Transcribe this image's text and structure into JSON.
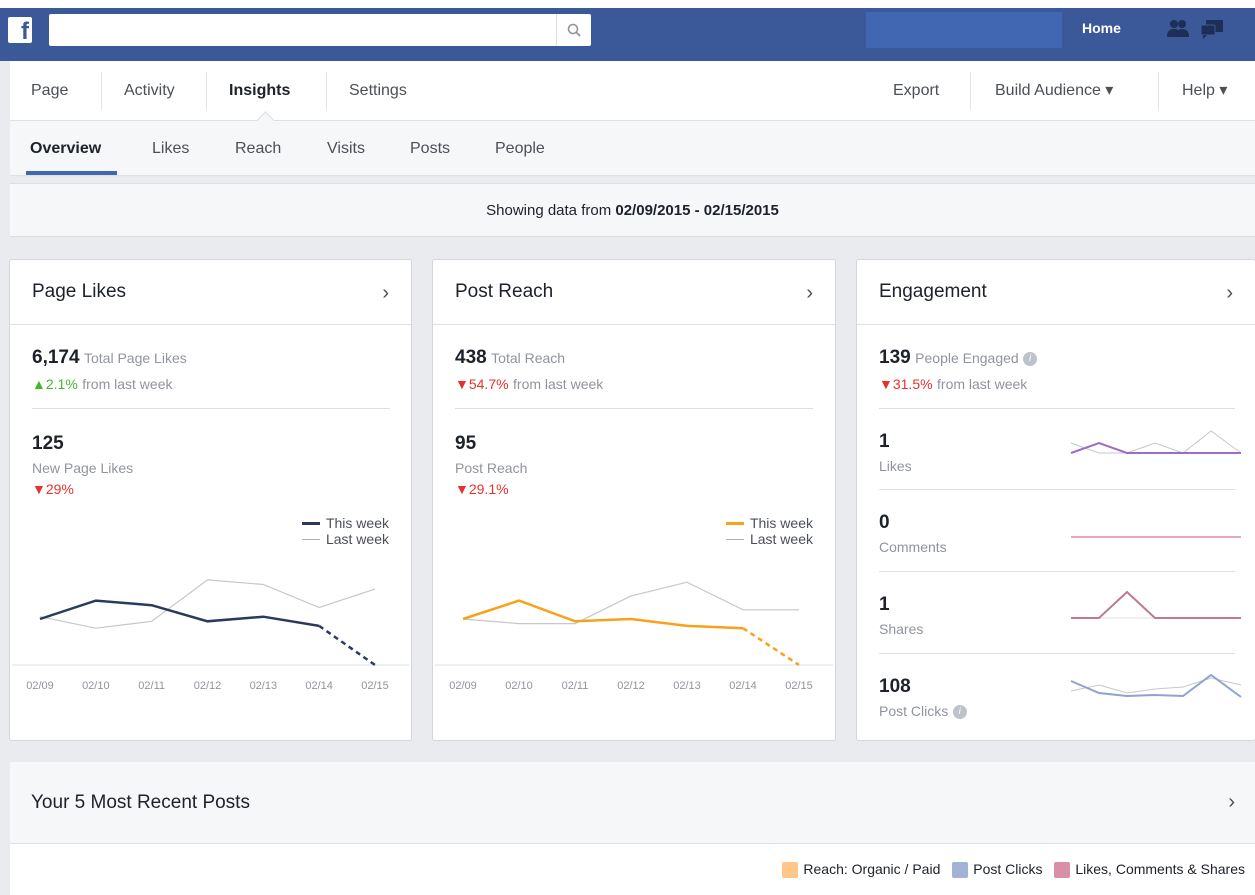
{
  "topbar": {
    "logo": "f",
    "search": {
      "value": "",
      "placeholder": ""
    },
    "home_label": "Home"
  },
  "page_nav": {
    "left": [
      "Page",
      "Activity",
      "Insights",
      "Settings"
    ],
    "right": [
      "Export",
      "Build Audience ▾",
      "Help ▾"
    ]
  },
  "sub_nav": [
    "Overview",
    "Likes",
    "Reach",
    "Visits",
    "Posts",
    "People"
  ],
  "date_range": {
    "prefix": "Showing data from ",
    "range": "02/09/2015 - 02/15/2015"
  },
  "cards": {
    "page_likes": {
      "title": "Page Likes",
      "total_value": "6,174",
      "total_label": "Total Page Likes",
      "total_change": "▲2.1%",
      "total_change_suffix": "from last week",
      "new_value": "125",
      "new_label": "New Page Likes",
      "new_change": "▼29%",
      "legend_this": "This week",
      "legend_last": "Last week"
    },
    "post_reach": {
      "title": "Post Reach",
      "total_value": "438",
      "total_label": "Total Reach",
      "total_change": "▼54.7%",
      "total_change_suffix": "from last week",
      "new_value": "95",
      "new_label": "Post Reach",
      "new_change": "▼29.1%",
      "legend_this": "This week",
      "legend_last": "Last week"
    },
    "engagement": {
      "title": "Engagement",
      "total_value": "139",
      "total_label": "People Engaged",
      "total_change": "▼31.5%",
      "total_change_suffix": "from last week",
      "metrics": [
        {
          "value": "1",
          "label": "Likes"
        },
        {
          "value": "0",
          "label": "Comments"
        },
        {
          "value": "1",
          "label": "Shares"
        },
        {
          "value": "108",
          "label": "Post Clicks"
        }
      ]
    }
  },
  "recent_posts": {
    "title": "Your 5 Most Recent Posts",
    "legend": [
      "Reach: Organic / Paid",
      "Post Clicks",
      "Likes, Comments & Shares"
    ]
  },
  "colors": {
    "fb_blue": "#3b5998",
    "likes_series": "#2b3a5c",
    "reach_series": "#f7a21b",
    "last_week": "#c4c7cc",
    "eng_likes": "#9b6dc6",
    "eng_comments": "#e3a9bb",
    "eng_shares": "#c07a90",
    "eng_clicks": "#8fa3cc",
    "legend_reach": "#fdc88a",
    "legend_clicks": "#a3b3d8",
    "legend_engage": "#d890a8"
  },
  "chart_data": [
    {
      "type": "line",
      "title": "Page Likes",
      "x": [
        "02/09",
        "02/10",
        "02/11",
        "02/12",
        "02/13",
        "02/14",
        "02/15"
      ],
      "series": [
        {
          "name": "This week",
          "values": [
            20,
            28,
            26,
            19,
            21,
            17,
            0
          ]
        },
        {
          "name": "Last week",
          "values": [
            21,
            16,
            19,
            37,
            35,
            25,
            33
          ]
        }
      ],
      "ylim": [
        0,
        50
      ]
    },
    {
      "type": "line",
      "title": "Post Reach",
      "x": [
        "02/09",
        "02/10",
        "02/11",
        "02/12",
        "02/13",
        "02/14",
        "02/15"
      ],
      "series": [
        {
          "name": "This week",
          "values": [
            20,
            28,
            19,
            20,
            17,
            16,
            0
          ]
        },
        {
          "name": "Last week",
          "values": [
            20,
            18,
            18,
            30,
            36,
            24,
            24
          ]
        }
      ],
      "ylim": [
        0,
        50
      ]
    }
  ]
}
